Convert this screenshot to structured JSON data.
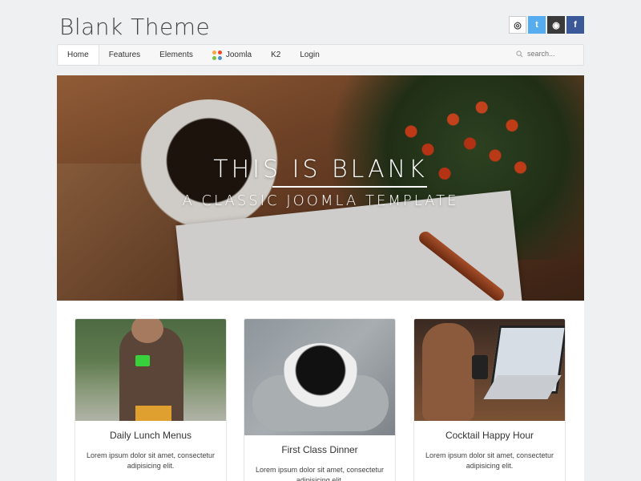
{
  "header": {
    "logo": "Blank Theme",
    "social": [
      {
        "icon": "github-icon",
        "glyph": "◎"
      },
      {
        "icon": "twitter-icon",
        "glyph": "t"
      },
      {
        "icon": "dribbble-icon",
        "glyph": "◉"
      },
      {
        "icon": "facebook-icon",
        "glyph": "f"
      }
    ]
  },
  "nav": {
    "items": [
      "Home",
      "Features",
      "Elements",
      "Joomla",
      "K2",
      "Login"
    ],
    "search_placeholder": "search..."
  },
  "hero": {
    "title": "THIS IS BLANK",
    "subtitle": "A CLASSIC JOOMLA TEMPLATE"
  },
  "cards": [
    {
      "title": "Daily Lunch Menus",
      "text": "Lorem ipsum dolor sit amet, consectetur adipisicing elit."
    },
    {
      "title": "First Class Dinner",
      "text": "Lorem ipsum dolor sit amet, consectetur adipisicing elit."
    },
    {
      "title": "Cocktail Happy Hour",
      "text": "Lorem ipsum dolor sit amet, consectetur adipisicing elit."
    }
  ],
  "colors": {
    "background": "#eef0f2",
    "twitter": "#55acee",
    "dribbble": "#3a3a3a",
    "facebook": "#3b5998"
  }
}
